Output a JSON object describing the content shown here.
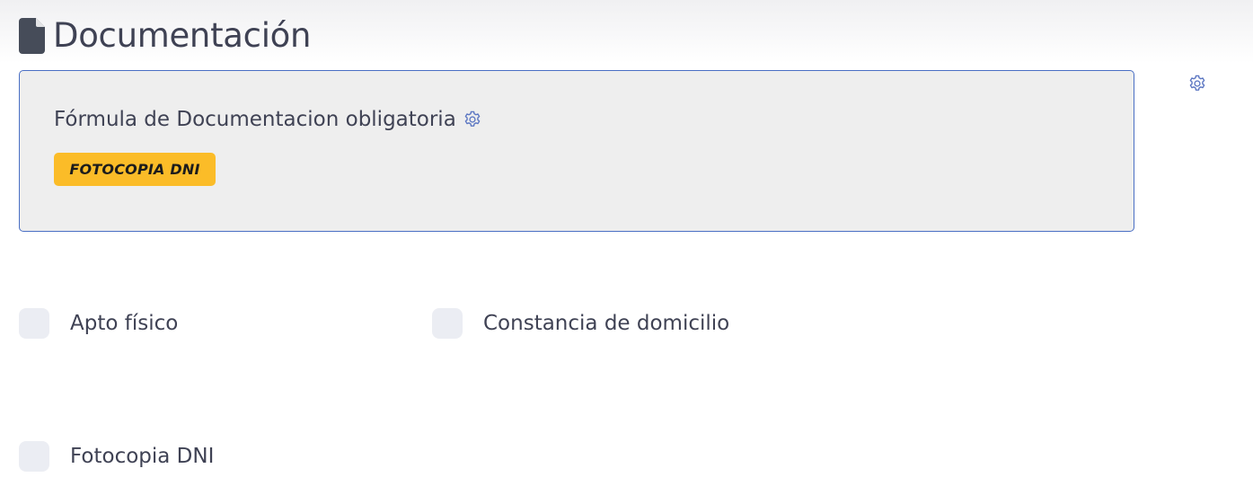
{
  "header": {
    "title": "Documentación",
    "icon": "file-icon"
  },
  "settings": {
    "icon": "gear-icon",
    "color": "#5b76c2"
  },
  "formula": {
    "title": "Fórmula de Documentacion obligatoria",
    "badge_label": "FOTOCOPIA DNI",
    "badge_color": "#fbbc28",
    "border_color": "#4a6fc4"
  },
  "documents": [
    {
      "label": "Apto físico",
      "checked": false
    },
    {
      "label": "Constancia de domicilio",
      "checked": false
    },
    {
      "label": "Fotocopia DNI",
      "checked": false
    }
  ]
}
